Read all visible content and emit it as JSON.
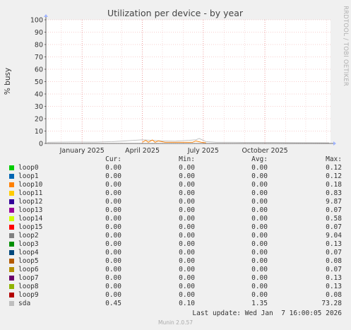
{
  "chart_data": {
    "type": "line",
    "title": "Utilization per device - by year",
    "ylabel": "% busy",
    "xlabel": "",
    "ylim": [
      0,
      100
    ],
    "yticks": [
      0,
      10,
      20,
      30,
      40,
      50,
      60,
      70,
      80,
      90,
      100
    ],
    "xlim": [
      "2024-11-08",
      "2026-01-07"
    ],
    "xticks": [
      {
        "label": "January 2025",
        "date": "2025-01-01"
      },
      {
        "label": "April 2025",
        "date": "2025-04-01"
      },
      {
        "label": "July 2025",
        "date": "2025-07-01"
      },
      {
        "label": "October 2025",
        "date": "2025-10-01"
      }
    ],
    "grid": true,
    "side_label": "RRDTOOL / TOBI OETIKER",
    "series": [
      {
        "name": "sda",
        "color": "#bbbbbb",
        "x": [
          "2024-11-10",
          "2024-12-15",
          "2025-01-20",
          "2025-02-15",
          "2025-03-05",
          "2025-03-20",
          "2025-04-01",
          "2025-04-15",
          "2025-05-01",
          "2025-05-20",
          "2025-06-10",
          "2025-06-20",
          "2025-06-25",
          "2025-07-05",
          "2025-07-20",
          "2025-08-15",
          "2025-09-15",
          "2025-10-15",
          "2025-11-15",
          "2025-12-15",
          "2026-01-05"
        ],
        "y": [
          1.0,
          1.2,
          1.1,
          1.5,
          2.0,
          2.5,
          3.0,
          2.5,
          2.0,
          1.8,
          2.5,
          3.0,
          4.0,
          1.5,
          1.0,
          1.0,
          0.8,
          0.8,
          0.7,
          0.6,
          0.5
        ]
      },
      {
        "name": "loop2",
        "color": "#ff8000",
        "x": [
          "2025-04-01",
          "2025-04-06",
          "2025-04-10",
          "2025-04-16",
          "2025-04-20",
          "2025-04-25",
          "2025-05-05",
          "2025-06-15",
          "2025-06-20",
          "2025-06-28",
          "2025-07-05"
        ],
        "y": [
          1.0,
          2.5,
          1.0,
          2.8,
          1.0,
          2.0,
          1.0,
          1.0,
          2.0,
          1.0,
          0.5
        ]
      }
    ],
    "legend": {
      "headers": {
        "cur": "Cur:",
        "min": "Min:",
        "avg": "Avg:",
        "max": "Max:"
      },
      "rows": [
        {
          "name": "loop0",
          "color": "#00cc00",
          "cur": "0.00",
          "min": "0.00",
          "avg": "0.00",
          "max": "0.12"
        },
        {
          "name": "loop1",
          "color": "#0066b3",
          "cur": "0.00",
          "min": "0.00",
          "avg": "0.00",
          "max": "0.12"
        },
        {
          "name": "loop10",
          "color": "#ff8000",
          "cur": "0.00",
          "min": "0.00",
          "avg": "0.00",
          "max": "0.18"
        },
        {
          "name": "loop11",
          "color": "#ffcc00",
          "cur": "0.00",
          "min": "0.00",
          "avg": "0.00",
          "max": "0.83"
        },
        {
          "name": "loop12",
          "color": "#330099",
          "cur": "0.00",
          "min": "0.00",
          "avg": "0.00",
          "max": "9.87"
        },
        {
          "name": "loop13",
          "color": "#990099",
          "cur": "0.00",
          "min": "0.00",
          "avg": "0.00",
          "max": "0.07"
        },
        {
          "name": "loop14",
          "color": "#ccff00",
          "cur": "0.00",
          "min": "0.00",
          "avg": "0.00",
          "max": "0.58"
        },
        {
          "name": "loop15",
          "color": "#ff0000",
          "cur": "0.00",
          "min": "0.00",
          "avg": "0.00",
          "max": "0.07"
        },
        {
          "name": "loop2",
          "color": "#808080",
          "cur": "0.00",
          "min": "0.00",
          "avg": "0.00",
          "max": "9.04"
        },
        {
          "name": "loop3",
          "color": "#008f00",
          "cur": "0.00",
          "min": "0.00",
          "avg": "0.00",
          "max": "0.13"
        },
        {
          "name": "loop4",
          "color": "#00487d",
          "cur": "0.00",
          "min": "0.00",
          "avg": "0.00",
          "max": "0.07"
        },
        {
          "name": "loop5",
          "color": "#b35a00",
          "cur": "0.00",
          "min": "0.00",
          "avg": "0.00",
          "max": "0.08"
        },
        {
          "name": "loop6",
          "color": "#b38f00",
          "cur": "0.00",
          "min": "0.00",
          "avg": "0.00",
          "max": "0.07"
        },
        {
          "name": "loop7",
          "color": "#6b006b",
          "cur": "0.00",
          "min": "0.00",
          "avg": "0.00",
          "max": "0.13"
        },
        {
          "name": "loop8",
          "color": "#8fb300",
          "cur": "0.00",
          "min": "0.00",
          "avg": "0.00",
          "max": "0.13"
        },
        {
          "name": "loop9",
          "color": "#b30000",
          "cur": "0.00",
          "min": "0.00",
          "avg": "0.00",
          "max": "0.08"
        },
        {
          "name": "sda",
          "color": "#bebebe",
          "cur": "0.45",
          "min": "0.10",
          "avg": "1.35",
          "max": "73.28"
        }
      ]
    }
  },
  "footer": {
    "last_update": "Last update: Wed Jan  7 16:00:05 2026",
    "version": "Munin 2.0.57"
  }
}
